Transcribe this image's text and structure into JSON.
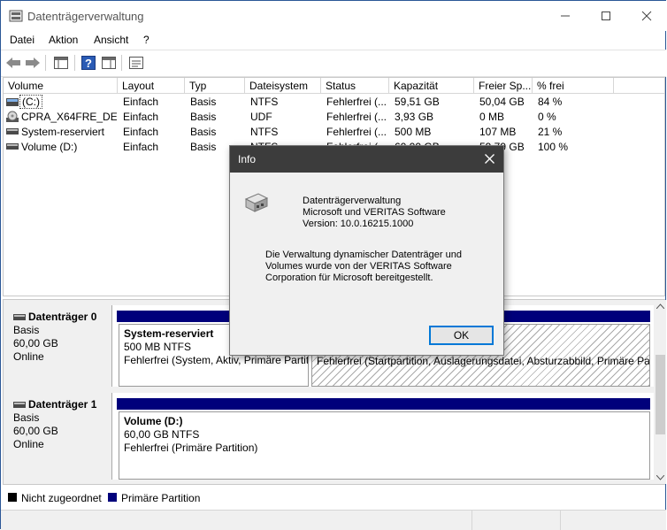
{
  "window": {
    "title": "Datenträgerverwaltung"
  },
  "menu": {
    "items": [
      "Datei",
      "Aktion",
      "Ansicht",
      "?"
    ]
  },
  "table": {
    "headers": [
      "Volume",
      "Layout",
      "Typ",
      "Dateisystem",
      "Status",
      "Kapazität",
      "Freier Sp...",
      "% frei"
    ],
    "rows": [
      [
        "(C:)",
        "Einfach",
        "Basis",
        "NTFS",
        "Fehlerfrei (...",
        "59,51 GB",
        "50,04 GB",
        "84 %"
      ],
      [
        "CPRA_X64FRE_DE-...",
        "Einfach",
        "Basis",
        "UDF",
        "Fehlerfrei (...",
        "3,93 GB",
        "0 MB",
        "0 %"
      ],
      [
        "System-reserviert",
        "Einfach",
        "Basis",
        "NTFS",
        "Fehlerfrei (...",
        "500 MB",
        "107 MB",
        "21 %"
      ],
      [
        "Volume (D:)",
        "Einfach",
        "Basis",
        "NTFS",
        "Fehlerfrei (...",
        "60,00 GB",
        "59,79 GB",
        "100 %"
      ]
    ]
  },
  "disks": [
    {
      "name": "Datenträger 0",
      "type": "Basis",
      "size": "60,00 GB",
      "status": "Online",
      "partitions": [
        {
          "name": "System-reserviert",
          "size": "500 MB NTFS",
          "status": "Fehlerfrei (System, Aktiv, Primäre Partition)"
        },
        {
          "status": "Fehlerfrei (Startpartition, Auslagerungsdatei, Absturzabbild, Primäre Partition)"
        }
      ]
    },
    {
      "name": "Datenträger 1",
      "type": "Basis",
      "size": "60,00 GB",
      "status": "Online",
      "partitions": [
        {
          "name": "Volume  (D:)",
          "size": "60,00 GB NTFS",
          "status": "Fehlerfrei (Primäre Partition)"
        }
      ]
    }
  ],
  "legend": [
    {
      "label": "Nicht zugeordnet",
      "color": "#000000"
    },
    {
      "label": "Primäre Partition",
      "color": "#00007b"
    }
  ],
  "dialog": {
    "title": "Info",
    "line1": "Datenträgerverwaltung",
    "line2": "Microsoft und VERITAS Software",
    "line3": "Version: 10.0.16215.1000",
    "desc1": "Die Verwaltung dynamischer Datenträger und",
    "desc2": "Volumes wurde von der VERITAS Software",
    "desc3": "Corporation für Microsoft bereitgestellt.",
    "ok_label": "OK"
  }
}
